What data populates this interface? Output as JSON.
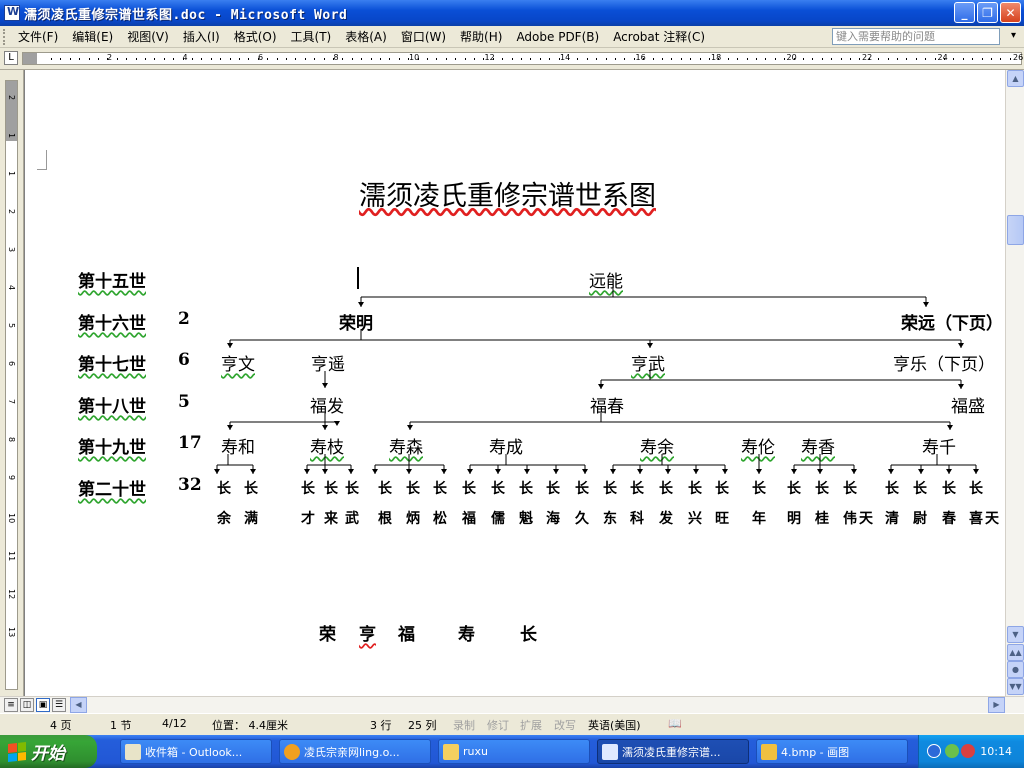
{
  "window": {
    "title": "濡须凌氏重修宗谱世系图.doc - Microsoft Word",
    "min": "_",
    "restore": "❐",
    "close": "✕"
  },
  "menu": {
    "items": [
      "文件(F)",
      "编辑(E)",
      "视图(V)",
      "插入(I)",
      "格式(O)",
      "工具(T)",
      "表格(A)",
      "窗口(W)",
      "帮助(H)",
      "Adobe PDF(B)",
      "Acrobat 注释(C)"
    ],
    "help_placeholder": "键入需要帮助的问题",
    "help_arrow": "▾"
  },
  "ruler": {
    "tab_marker": "L",
    "numbers": [
      "2",
      "4",
      "6",
      "8",
      "10",
      "12",
      "14",
      "16",
      "18",
      "20",
      "22",
      "24",
      "26"
    ],
    "vertical_numbers": [
      "2",
      "1",
      "1",
      "2",
      "3",
      "4",
      "5",
      "6",
      "7",
      "8",
      "9",
      "10",
      "11",
      "12",
      "13"
    ]
  },
  "document": {
    "title": "濡须凌氏重修宗谱世系图",
    "generations": [
      {
        "label": "第十五世",
        "count": ""
      },
      {
        "label": "第十六世",
        "count": "2"
      },
      {
        "label": "第十七世",
        "count": "6"
      },
      {
        "label": "第十八世",
        "count": "5"
      },
      {
        "label": "第十九世",
        "count": "17"
      },
      {
        "label": "第二十世",
        "count": "32"
      }
    ],
    "gen15": [
      "远能"
    ],
    "gen16": [
      "荣明",
      "荣远（下页）"
    ],
    "gen17": [
      "亨文",
      "亨遥",
      "亨武",
      "亨乐（下页）"
    ],
    "gen18": [
      "福发",
      "福春",
      "福盛"
    ],
    "gen19": [
      "寿和",
      "寿枝",
      "寿森",
      "寿成",
      "寿余",
      "寿伦",
      "寿香",
      "寿千"
    ],
    "gen20_prefix": "长",
    "gen20": [
      "余",
      "满",
      "才",
      "来",
      "武",
      "根",
      "炳",
      "松",
      "福",
      "儒",
      "魁",
      "海",
      "久",
      "东",
      "科",
      "发",
      "兴",
      "旺",
      "年",
      "明",
      "桂",
      "伟",
      "天",
      "清",
      "尉",
      "春",
      "喜",
      "天"
    ],
    "footer_chars": [
      "荣",
      "亨",
      "福",
      "寿",
      "长"
    ]
  },
  "status": {
    "page": "4 页",
    "section": "1 节",
    "page_of": "4/12",
    "position": "位置： 4.4厘米",
    "line": "3 行",
    "column": "25 列",
    "rec": "录制",
    "trk": "修订",
    "ext": "扩展",
    "ovr": "改写",
    "language": "英语(美国)"
  },
  "taskbar": {
    "start": "开始",
    "buttons": [
      {
        "label": "收件箱 - Outlook...",
        "active": false
      },
      {
        "label": "凌氏宗亲网ling.o...",
        "active": false
      },
      {
        "label": "ruxu",
        "active": false
      },
      {
        "label": "濡须凌氏重修宗谱...",
        "active": true
      },
      {
        "label": "4.bmp - 画图",
        "active": false
      }
    ],
    "clock": "10:14"
  },
  "colors": {
    "titlebar": "#0a4fd6",
    "taskbar": "#245edb",
    "start": "#37a537",
    "tree_line": "#000000"
  }
}
